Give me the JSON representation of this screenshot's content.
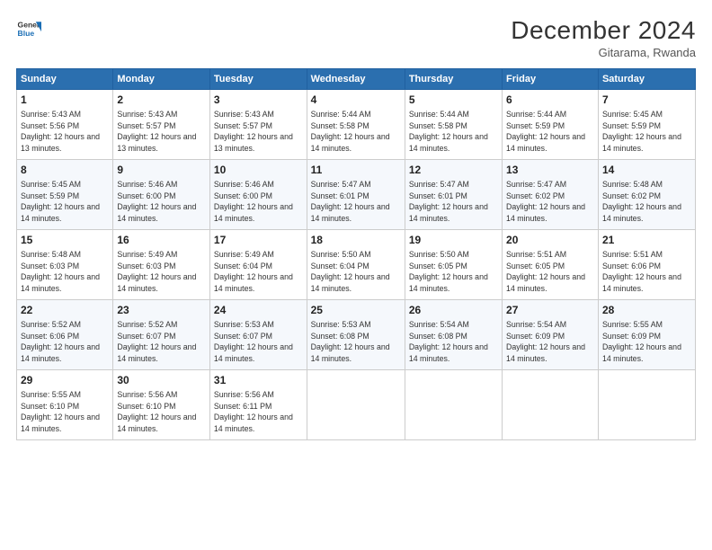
{
  "header": {
    "logo_line1": "General",
    "logo_line2": "Blue",
    "title": "December 2024",
    "subtitle": "Gitarama, Rwanda"
  },
  "days_of_week": [
    "Sunday",
    "Monday",
    "Tuesday",
    "Wednesday",
    "Thursday",
    "Friday",
    "Saturday"
  ],
  "weeks": [
    [
      {
        "day": "1",
        "sunrise": "5:43 AM",
        "sunset": "5:56 PM",
        "daylight": "12 hours and 13 minutes."
      },
      {
        "day": "2",
        "sunrise": "5:43 AM",
        "sunset": "5:57 PM",
        "daylight": "12 hours and 13 minutes."
      },
      {
        "day": "3",
        "sunrise": "5:43 AM",
        "sunset": "5:57 PM",
        "daylight": "12 hours and 13 minutes."
      },
      {
        "day": "4",
        "sunrise": "5:44 AM",
        "sunset": "5:58 PM",
        "daylight": "12 hours and 14 minutes."
      },
      {
        "day": "5",
        "sunrise": "5:44 AM",
        "sunset": "5:58 PM",
        "daylight": "12 hours and 14 minutes."
      },
      {
        "day": "6",
        "sunrise": "5:44 AM",
        "sunset": "5:59 PM",
        "daylight": "12 hours and 14 minutes."
      },
      {
        "day": "7",
        "sunrise": "5:45 AM",
        "sunset": "5:59 PM",
        "daylight": "12 hours and 14 minutes."
      }
    ],
    [
      {
        "day": "8",
        "sunrise": "5:45 AM",
        "sunset": "5:59 PM",
        "daylight": "12 hours and 14 minutes."
      },
      {
        "day": "9",
        "sunrise": "5:46 AM",
        "sunset": "6:00 PM",
        "daylight": "12 hours and 14 minutes."
      },
      {
        "day": "10",
        "sunrise": "5:46 AM",
        "sunset": "6:00 PM",
        "daylight": "12 hours and 14 minutes."
      },
      {
        "day": "11",
        "sunrise": "5:47 AM",
        "sunset": "6:01 PM",
        "daylight": "12 hours and 14 minutes."
      },
      {
        "day": "12",
        "sunrise": "5:47 AM",
        "sunset": "6:01 PM",
        "daylight": "12 hours and 14 minutes."
      },
      {
        "day": "13",
        "sunrise": "5:47 AM",
        "sunset": "6:02 PM",
        "daylight": "12 hours and 14 minutes."
      },
      {
        "day": "14",
        "sunrise": "5:48 AM",
        "sunset": "6:02 PM",
        "daylight": "12 hours and 14 minutes."
      }
    ],
    [
      {
        "day": "15",
        "sunrise": "5:48 AM",
        "sunset": "6:03 PM",
        "daylight": "12 hours and 14 minutes."
      },
      {
        "day": "16",
        "sunrise": "5:49 AM",
        "sunset": "6:03 PM",
        "daylight": "12 hours and 14 minutes."
      },
      {
        "day": "17",
        "sunrise": "5:49 AM",
        "sunset": "6:04 PM",
        "daylight": "12 hours and 14 minutes."
      },
      {
        "day": "18",
        "sunrise": "5:50 AM",
        "sunset": "6:04 PM",
        "daylight": "12 hours and 14 minutes."
      },
      {
        "day": "19",
        "sunrise": "5:50 AM",
        "sunset": "6:05 PM",
        "daylight": "12 hours and 14 minutes."
      },
      {
        "day": "20",
        "sunrise": "5:51 AM",
        "sunset": "6:05 PM",
        "daylight": "12 hours and 14 minutes."
      },
      {
        "day": "21",
        "sunrise": "5:51 AM",
        "sunset": "6:06 PM",
        "daylight": "12 hours and 14 minutes."
      }
    ],
    [
      {
        "day": "22",
        "sunrise": "5:52 AM",
        "sunset": "6:06 PM",
        "daylight": "12 hours and 14 minutes."
      },
      {
        "day": "23",
        "sunrise": "5:52 AM",
        "sunset": "6:07 PM",
        "daylight": "12 hours and 14 minutes."
      },
      {
        "day": "24",
        "sunrise": "5:53 AM",
        "sunset": "6:07 PM",
        "daylight": "12 hours and 14 minutes."
      },
      {
        "day": "25",
        "sunrise": "5:53 AM",
        "sunset": "6:08 PM",
        "daylight": "12 hours and 14 minutes."
      },
      {
        "day": "26",
        "sunrise": "5:54 AM",
        "sunset": "6:08 PM",
        "daylight": "12 hours and 14 minutes."
      },
      {
        "day": "27",
        "sunrise": "5:54 AM",
        "sunset": "6:09 PM",
        "daylight": "12 hours and 14 minutes."
      },
      {
        "day": "28",
        "sunrise": "5:55 AM",
        "sunset": "6:09 PM",
        "daylight": "12 hours and 14 minutes."
      }
    ],
    [
      {
        "day": "29",
        "sunrise": "5:55 AM",
        "sunset": "6:10 PM",
        "daylight": "12 hours and 14 minutes."
      },
      {
        "day": "30",
        "sunrise": "5:56 AM",
        "sunset": "6:10 PM",
        "daylight": "12 hours and 14 minutes."
      },
      {
        "day": "31",
        "sunrise": "5:56 AM",
        "sunset": "6:11 PM",
        "daylight": "12 hours and 14 minutes."
      },
      null,
      null,
      null,
      null
    ]
  ],
  "labels": {
    "sunrise": "Sunrise:",
    "sunset": "Sunset:",
    "daylight": "Daylight:"
  }
}
